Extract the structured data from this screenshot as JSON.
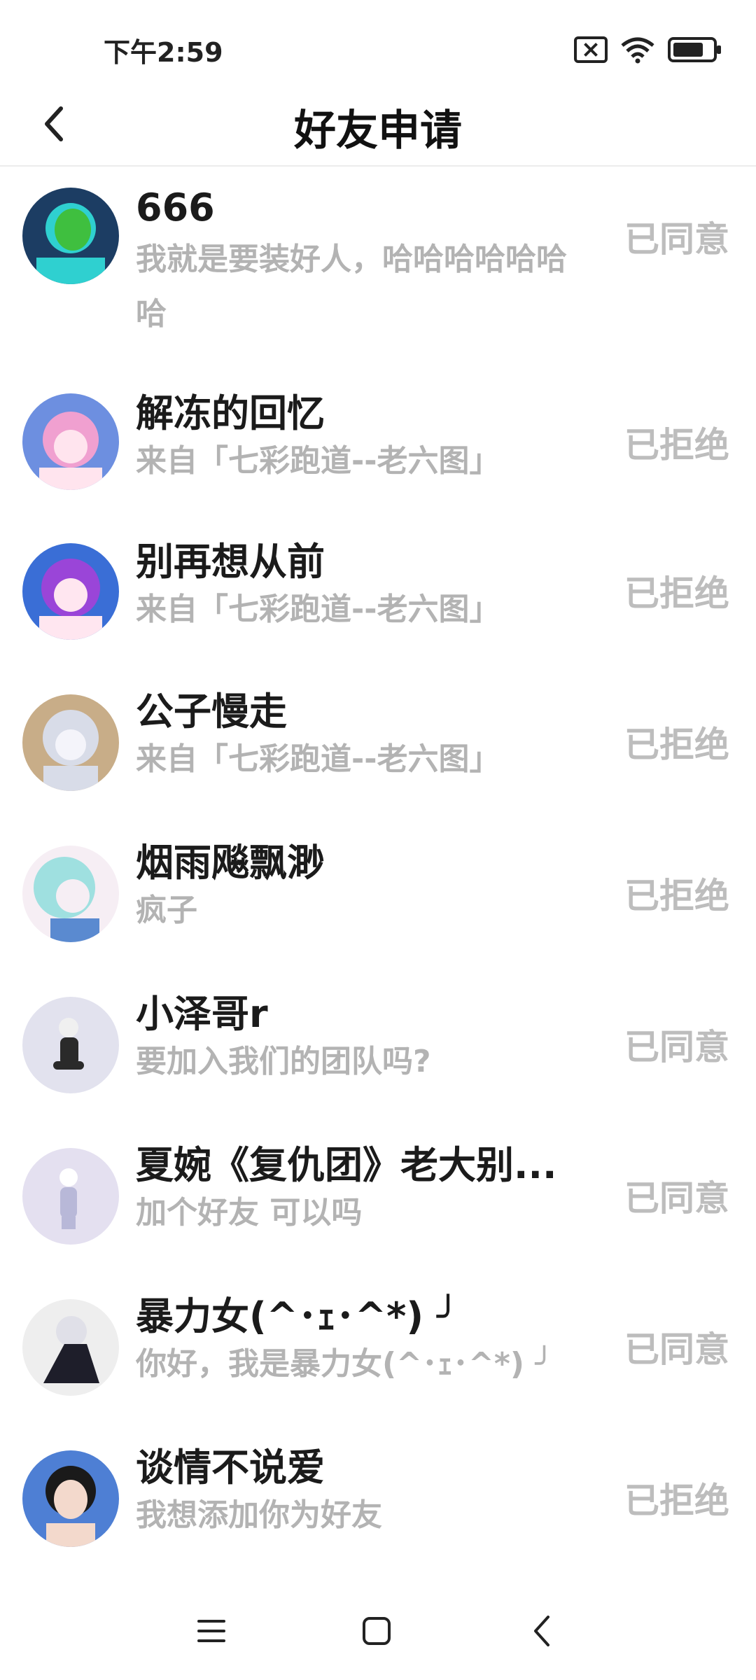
{
  "status_bar": {
    "time": "下午2:59"
  },
  "header": {
    "title": "好友申请"
  },
  "requests": [
    {
      "name": "666",
      "message": "我就是要装好人，哈哈哈哈哈哈哈",
      "status": "已同意",
      "avatar_colors": [
        "#1c3d63",
        "#2fd0d0",
        "#3fbf3f"
      ]
    },
    {
      "name": "解冻的回忆",
      "message": "来自「七彩跑道--老六图」",
      "status": "已拒绝",
      "avatar_colors": [
        "#6d8fe0",
        "#f0a0d0",
        "#ffe4ee"
      ]
    },
    {
      "name": "别再想从前",
      "message": "来自「七彩跑道--老六图」",
      "status": "已拒绝",
      "avatar_colors": [
        "#3a6ed6",
        "#9a45d8",
        "#ffe6f0"
      ]
    },
    {
      "name": "公子慢走",
      "message": "来自「七彩跑道--老六图」",
      "status": "已拒绝",
      "avatar_colors": [
        "#c8ad88",
        "#d8dce8",
        "#f4f4fa"
      ]
    },
    {
      "name": "烟雨飚飘渺",
      "message": "疯子",
      "status": "已拒绝",
      "avatar_colors": [
        "#5a8ad0",
        "#9fe0e0",
        "#f6eef4"
      ]
    },
    {
      "name": "小泽哥r",
      "message": "要加入我们的团队吗?",
      "status": "已同意",
      "avatar_colors": [
        "#e2e2ee",
        "#2a2a2a",
        "#f0f0f0"
      ]
    },
    {
      "name": "夏婉《复仇团》老大别...",
      "message": "加个好友 可以吗",
      "status": "已同意",
      "avatar_colors": [
        "#e4e0f0",
        "#b8b8d8",
        "#ffffff"
      ]
    },
    {
      "name": "暴力女(^･ｪ･^*) ╯",
      "message": "你好，我是暴力女(^･ｪ･^*) ╯",
      "status": "已同意",
      "avatar_colors": [
        "#eeeeee",
        "#1e1e2a",
        "#e0e0e8"
      ]
    },
    {
      "name": "谈情不说爱",
      "message": "我想添加你为好友",
      "status": "已拒绝",
      "avatar_colors": [
        "#4e7fd4",
        "#1a1a1a",
        "#f3d9cc"
      ]
    }
  ],
  "nav": {
    "menu_icon": "menu-icon",
    "home_icon": "home-icon",
    "back_icon": "back-icon"
  }
}
